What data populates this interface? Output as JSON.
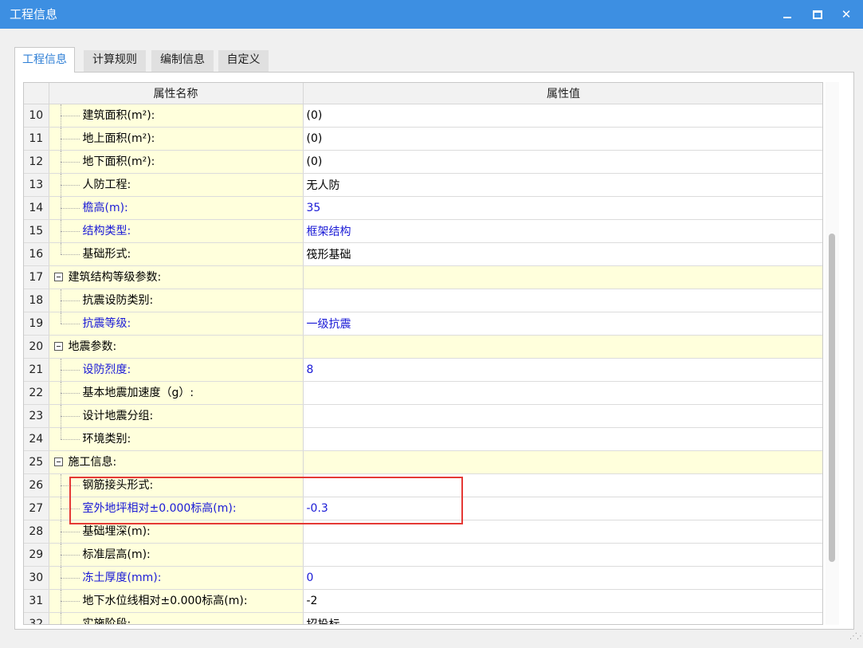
{
  "window": {
    "title": "工程信息",
    "min_label": "–",
    "max_label": "□",
    "close_label": "✕"
  },
  "tabs": [
    {
      "label": "工程信息",
      "active": true
    },
    {
      "label": "计算规则",
      "active": false
    },
    {
      "label": "编制信息",
      "active": false
    },
    {
      "label": "自定义",
      "active": false
    }
  ],
  "table": {
    "headers": [
      "",
      "属性名称",
      "属性值"
    ],
    "rows": [
      {
        "num": "10",
        "name": "建筑面积(m²):",
        "value": "(0)",
        "type": "child",
        "blue": false
      },
      {
        "num": "11",
        "name": "地上面积(m²):",
        "value": "(0)",
        "type": "child",
        "blue": false
      },
      {
        "num": "12",
        "name": "地下面积(m²):",
        "value": "(0)",
        "type": "child",
        "blue": false
      },
      {
        "num": "13",
        "name": "人防工程:",
        "value": "无人防",
        "type": "child",
        "blue": false
      },
      {
        "num": "14",
        "name": "檐高(m):",
        "value": "35",
        "type": "child",
        "blue": true
      },
      {
        "num": "15",
        "name": "结构类型:",
        "value": "框架结构",
        "type": "child",
        "blue": true
      },
      {
        "num": "16",
        "name": "基础形式:",
        "value": "筏形基础",
        "type": "child-last",
        "blue": false
      },
      {
        "num": "17",
        "name": "建筑结构等级参数:",
        "value": "",
        "type": "group",
        "blue": false
      },
      {
        "num": "18",
        "name": "抗震设防类别:",
        "value": "",
        "type": "child",
        "blue": false
      },
      {
        "num": "19",
        "name": "抗震等级:",
        "value": "一级抗震",
        "type": "child-last",
        "blue": true
      },
      {
        "num": "20",
        "name": "地震参数:",
        "value": "",
        "type": "group",
        "blue": false
      },
      {
        "num": "21",
        "name": "设防烈度:",
        "value": "8",
        "type": "child",
        "blue": true
      },
      {
        "num": "22",
        "name": "基本地震加速度（g）:",
        "value": "",
        "type": "child",
        "blue": false
      },
      {
        "num": "23",
        "name": "设计地震分组:",
        "value": "",
        "type": "child",
        "blue": false
      },
      {
        "num": "24",
        "name": "环境类别:",
        "value": "",
        "type": "child-last",
        "blue": false
      },
      {
        "num": "25",
        "name": "施工信息:",
        "value": "",
        "type": "group",
        "blue": false
      },
      {
        "num": "26",
        "name": "钢筋接头形式:",
        "value": "",
        "type": "child",
        "blue": false
      },
      {
        "num": "27",
        "name": "室外地坪相对±0.000标高(m):",
        "value": "-0.3",
        "type": "child",
        "blue": true
      },
      {
        "num": "28",
        "name": "基础埋深(m):",
        "value": "",
        "type": "child",
        "blue": false
      },
      {
        "num": "29",
        "name": "标准层高(m):",
        "value": "",
        "type": "child",
        "blue": false
      },
      {
        "num": "30",
        "name": "冻土厚度(mm):",
        "value": "0",
        "type": "child",
        "blue": true
      },
      {
        "num": "31",
        "name": "地下水位线相对±0.000标高(m):",
        "value": "-2",
        "type": "child",
        "blue": false
      },
      {
        "num": "32",
        "name": "实施阶段:",
        "value": "招投标",
        "type": "child",
        "blue": false
      }
    ]
  },
  "colors": {
    "titlebar": "#3d8fe2",
    "highlight": "#e53935",
    "name_cell": "#ffffdc",
    "blue_text": "#1a1ad6"
  }
}
